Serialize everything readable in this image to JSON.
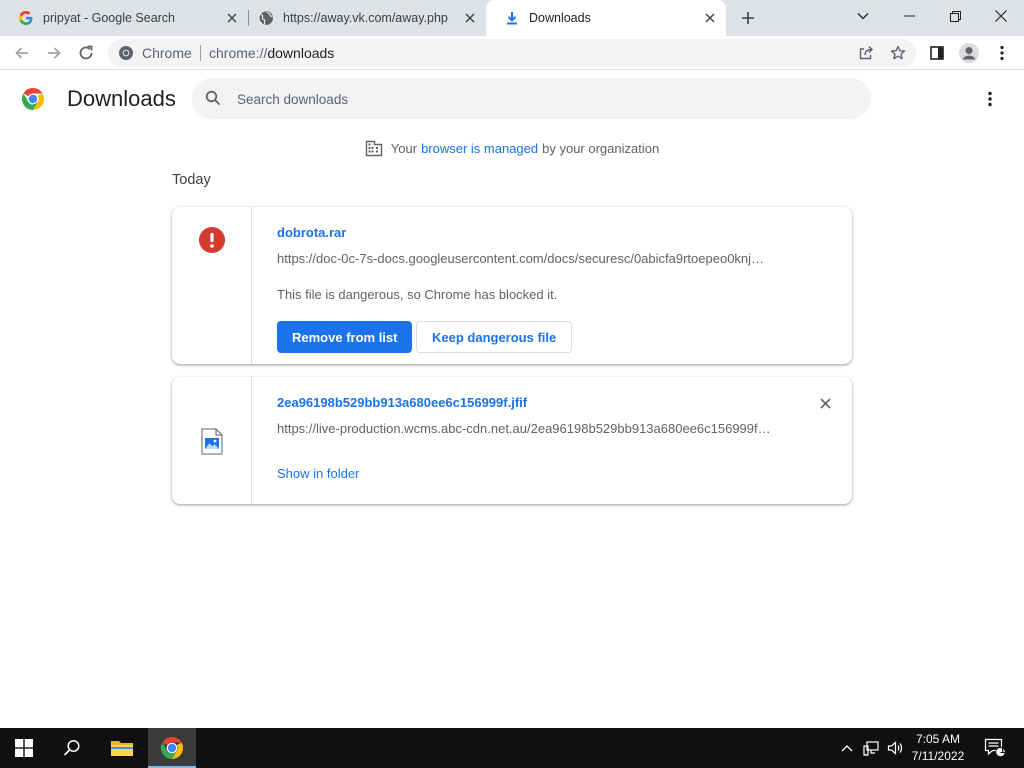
{
  "tabs": [
    {
      "title": "pripyat - Google Search",
      "icon": "google-g-icon"
    },
    {
      "title": "https://away.vk.com/away.php",
      "icon": "globe-icon"
    },
    {
      "title": "Downloads",
      "icon": "download-icon",
      "active": true
    }
  ],
  "toolbar": {
    "chip_label": "Chrome",
    "url_scheme": "chrome://",
    "url_host": "downloads"
  },
  "downloads_page": {
    "title": "Downloads",
    "search_placeholder": "Search downloads",
    "managed": {
      "before": "Your",
      "link": "browser is managed",
      "after": "by your organization"
    },
    "section_label": "Today",
    "items": [
      {
        "filename": "dobrota.rar",
        "url": "https://doc-0c-7s-docs.googleusercontent.com/docs/securesc/0abicfa9rtoepeo0knj…",
        "status": "This file is dangerous, so Chrome has blocked it.",
        "primary_action": "Remove from list",
        "secondary_action": "Keep dangerous file",
        "icon": "warning-icon"
      },
      {
        "filename": "2ea96198b529bb913a680ee6c156999f.jfif",
        "url": "https://live-production.wcms.abc-cdn.net.au/2ea96198b529bb913a680ee6c156999f…",
        "link_action": "Show in folder",
        "icon": "image-file-icon"
      }
    ]
  },
  "taskbar": {
    "time": "7:05 AM",
    "date": "7/11/2022",
    "notification_count": "1"
  },
  "colors": {
    "accent": "#1a73e8",
    "danger": "#d93025",
    "tabstrip": "#dee1e6",
    "taskbar": "#101010"
  }
}
